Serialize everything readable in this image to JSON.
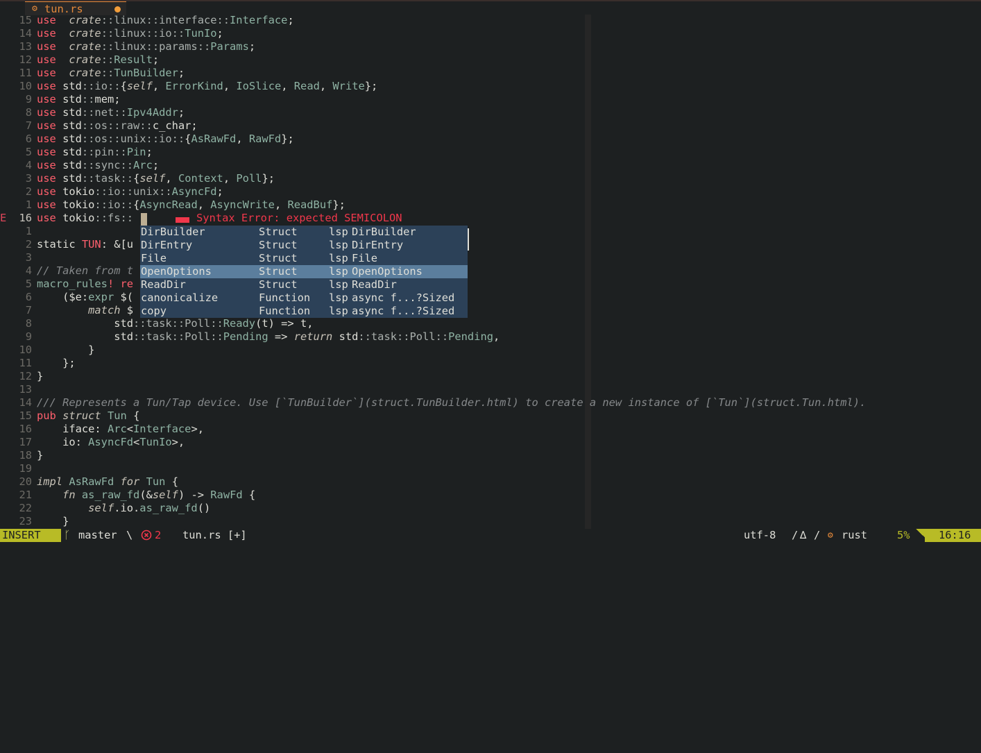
{
  "tab": {
    "icon": "rust-gear-icon",
    "name": "tun.rs",
    "modified": true
  },
  "lines": [
    {
      "num": "15",
      "parts": [
        [
          "kw",
          "use"
        ],
        [
          "",
          "  "
        ],
        [
          "it",
          "crate"
        ],
        [
          "ns",
          "::linux::interface::"
        ],
        [
          "ty",
          "Interface"
        ],
        [
          "",
          ";"
        ]
      ]
    },
    {
      "num": "14",
      "parts": [
        [
          "kw",
          "use"
        ],
        [
          "",
          "  "
        ],
        [
          "it",
          "crate"
        ],
        [
          "ns",
          "::linux::io::"
        ],
        [
          "ty",
          "TunIo"
        ],
        [
          "",
          ";"
        ]
      ]
    },
    {
      "num": "13",
      "parts": [
        [
          "kw",
          "use"
        ],
        [
          "",
          "  "
        ],
        [
          "it",
          "crate"
        ],
        [
          "ns",
          "::linux::params::"
        ],
        [
          "ty",
          "Params"
        ],
        [
          "",
          ";"
        ]
      ]
    },
    {
      "num": "12",
      "parts": [
        [
          "kw",
          "use"
        ],
        [
          "",
          "  "
        ],
        [
          "it",
          "crate"
        ],
        [
          "ns",
          "::"
        ],
        [
          "ty",
          "Result"
        ],
        [
          "",
          ";"
        ]
      ]
    },
    {
      "num": "11",
      "parts": [
        [
          "kw",
          "use"
        ],
        [
          "",
          "  "
        ],
        [
          "it",
          "crate"
        ],
        [
          "ns",
          "::"
        ],
        [
          "ty",
          "TunBuilder"
        ],
        [
          "",
          ";"
        ]
      ]
    },
    {
      "num": "10",
      "parts": [
        [
          "kw",
          "use"
        ],
        [
          "",
          " std"
        ],
        [
          "ns",
          "::io::"
        ],
        [
          "",
          "{"
        ],
        [
          "it",
          "self"
        ],
        [
          "",
          ", "
        ],
        [
          "ty",
          "ErrorKind"
        ],
        [
          "",
          ", "
        ],
        [
          "ty",
          "IoSlice"
        ],
        [
          "",
          ", "
        ],
        [
          "ty",
          "Read"
        ],
        [
          "",
          ", "
        ],
        [
          "ty",
          "Write"
        ],
        [
          "",
          "};"
        ]
      ]
    },
    {
      "num": "9",
      "parts": [
        [
          "kw",
          "use"
        ],
        [
          "",
          " std"
        ],
        [
          "ns",
          "::"
        ],
        [
          "",
          "mem;"
        ]
      ]
    },
    {
      "num": "8",
      "parts": [
        [
          "kw",
          "use"
        ],
        [
          "",
          " std"
        ],
        [
          "ns",
          "::net::"
        ],
        [
          "ty",
          "Ipv4Addr"
        ],
        [
          "",
          ";"
        ]
      ]
    },
    {
      "num": "7",
      "parts": [
        [
          "kw",
          "use"
        ],
        [
          "",
          " std"
        ],
        [
          "ns",
          "::os::raw::"
        ],
        [
          "",
          "c_char;"
        ]
      ]
    },
    {
      "num": "6",
      "parts": [
        [
          "kw",
          "use"
        ],
        [
          "",
          " std"
        ],
        [
          "ns",
          "::os::unix::io::"
        ],
        [
          "",
          "{"
        ],
        [
          "ty",
          "AsRawFd"
        ],
        [
          "",
          ", "
        ],
        [
          "ty",
          "RawFd"
        ],
        [
          "",
          "};"
        ]
      ]
    },
    {
      "num": "5",
      "parts": [
        [
          "kw",
          "use"
        ],
        [
          "",
          " std"
        ],
        [
          "ns",
          "::pin::"
        ],
        [
          "ty",
          "Pin"
        ],
        [
          "",
          ";"
        ]
      ]
    },
    {
      "num": "4",
      "parts": [
        [
          "kw",
          "use"
        ],
        [
          "",
          " std"
        ],
        [
          "ns",
          "::sync::"
        ],
        [
          "ty",
          "Arc"
        ],
        [
          "",
          ";"
        ]
      ]
    },
    {
      "num": "3",
      "parts": [
        [
          "kw",
          "use"
        ],
        [
          "",
          " std"
        ],
        [
          "ns",
          "::task::"
        ],
        [
          "",
          "{"
        ],
        [
          "it",
          "self"
        ],
        [
          "",
          ", "
        ],
        [
          "ty",
          "Context"
        ],
        [
          "",
          ", "
        ],
        [
          "ty",
          "Poll"
        ],
        [
          "",
          "};"
        ]
      ]
    },
    {
      "num": "2",
      "parts": [
        [
          "kw",
          "use"
        ],
        [
          "",
          " tokio"
        ],
        [
          "ns",
          "::io::unix::"
        ],
        [
          "ty",
          "AsyncFd"
        ],
        [
          "",
          ";"
        ]
      ]
    },
    {
      "num": "1",
      "parts": [
        [
          "kw",
          "use"
        ],
        [
          "",
          " tokio"
        ],
        [
          "ns",
          "::io::"
        ],
        [
          "",
          "{"
        ],
        [
          "ty",
          "AsyncRead"
        ],
        [
          "",
          ", "
        ],
        [
          "ty",
          "AsyncWrite"
        ],
        [
          "",
          ", "
        ],
        [
          "ty",
          "ReadBuf"
        ],
        [
          "",
          "};"
        ]
      ]
    },
    {
      "num": "16",
      "current": true,
      "sign": "E",
      "parts": [
        [
          "kw",
          "use"
        ],
        [
          "",
          " tokio"
        ],
        [
          "ns",
          "::fs::"
        ]
      ]
    },
    {
      "num": "1",
      "parts": []
    },
    {
      "num": "2",
      "parts": [
        [
          "",
          "static "
        ],
        [
          "kw",
          "TUN"
        ],
        [
          "",
          ": &[u"
        ]
      ]
    },
    {
      "num": "3",
      "parts": []
    },
    {
      "num": "4",
      "parts": [
        [
          "cm",
          "// Taken from t"
        ]
      ]
    },
    {
      "num": "5",
      "parts": [
        [
          "ty",
          "macro_rules"
        ],
        [
          "kw",
          "! re"
        ]
      ]
    },
    {
      "num": "6",
      "parts": [
        [
          "",
          "    ($e:"
        ],
        [
          "ty",
          "expr"
        ],
        [
          "",
          " $("
        ]
      ]
    },
    {
      "num": "7",
      "parts": [
        [
          "",
          "        "
        ],
        [
          "it",
          "match"
        ],
        [
          "",
          " $"
        ]
      ]
    },
    {
      "num": "8",
      "parts": [
        [
          "",
          "            std"
        ],
        [
          "ns",
          "::task::Poll::"
        ],
        [
          "ty",
          "Ready"
        ],
        [
          "",
          "(t) => t,"
        ]
      ]
    },
    {
      "num": "9",
      "parts": [
        [
          "",
          "            std"
        ],
        [
          "ns",
          "::task::Poll::"
        ],
        [
          "ty",
          "Pending"
        ],
        [
          "",
          " => "
        ],
        [
          "it",
          "return"
        ],
        [
          "",
          " std"
        ],
        [
          "ns",
          "::task::Poll::"
        ],
        [
          "ty",
          "Pending"
        ],
        [
          "",
          ","
        ]
      ]
    },
    {
      "num": "10",
      "parts": [
        [
          "",
          "        }"
        ]
      ]
    },
    {
      "num": "11",
      "parts": [
        [
          "",
          "    };"
        ]
      ]
    },
    {
      "num": "12",
      "parts": [
        [
          "",
          "}"
        ]
      ]
    },
    {
      "num": "13",
      "parts": []
    },
    {
      "num": "14",
      "parts": [
        [
          "cm",
          "/// Represents a Tun/Tap device. Use [`TunBuilder`](struct.TunBuilder.html) to create a new instance of [`Tun`](struct.Tun.html)."
        ]
      ]
    },
    {
      "num": "15",
      "parts": [
        [
          "kw",
          "pub"
        ],
        [
          "",
          " "
        ],
        [
          "it",
          "struct"
        ],
        [
          "",
          " "
        ],
        [
          "ty",
          "Tun"
        ],
        [
          "",
          " {"
        ]
      ]
    },
    {
      "num": "16",
      "parts": [
        [
          "",
          "    iface: "
        ],
        [
          "ty",
          "Arc"
        ],
        [
          "",
          "<"
        ],
        [
          "ty",
          "Interface"
        ],
        [
          "",
          ">,"
        ]
      ]
    },
    {
      "num": "17",
      "parts": [
        [
          "",
          "    io: "
        ],
        [
          "ty",
          "AsyncFd"
        ],
        [
          "",
          "<"
        ],
        [
          "ty",
          "TunIo"
        ],
        [
          "",
          ">,"
        ]
      ]
    },
    {
      "num": "18",
      "parts": [
        [
          "",
          "}"
        ]
      ]
    },
    {
      "num": "19",
      "parts": []
    },
    {
      "num": "20",
      "parts": [
        [
          "it",
          "impl"
        ],
        [
          "",
          " "
        ],
        [
          "ty",
          "AsRawFd"
        ],
        [
          "",
          " "
        ],
        [
          "it",
          "for"
        ],
        [
          "",
          " "
        ],
        [
          "ty",
          "Tun"
        ],
        [
          "",
          " {"
        ]
      ]
    },
    {
      "num": "21",
      "parts": [
        [
          "",
          "    "
        ],
        [
          "it",
          "fn"
        ],
        [
          "",
          " "
        ],
        [
          "ty",
          "as_raw_fd"
        ],
        [
          "",
          "(&"
        ],
        [
          "it",
          "self"
        ],
        [
          "",
          ") -> "
        ],
        [
          "ty",
          "RawFd"
        ],
        [
          "",
          " {"
        ]
      ]
    },
    {
      "num": "22",
      "parts": [
        [
          "",
          "        "
        ],
        [
          "it",
          "self"
        ],
        [
          "",
          ".io."
        ],
        [
          "ty",
          "as_raw_fd"
        ],
        [
          "",
          "()"
        ]
      ]
    },
    {
      "num": "23",
      "parts": [
        [
          "",
          "    }"
        ]
      ]
    }
  ],
  "diagnostic": {
    "message": "Syntax Error: expected SEMICOLON",
    "icon": "error-block-icon"
  },
  "completion": {
    "items": [
      {
        "word": "DirBuilder",
        "kind": "Struct",
        "menu": "lsp",
        "info": "DirBuilder",
        "selected": false
      },
      {
        "word": "DirEntry",
        "kind": "Struct",
        "menu": "lsp",
        "info": "DirEntry",
        "selected": false
      },
      {
        "word": "File",
        "kind": "Struct",
        "menu": "lsp",
        "info": "File",
        "selected": false
      },
      {
        "word": "OpenOptions",
        "kind": "Struct",
        "menu": "lsp",
        "info": "OpenOptions",
        "selected": true
      },
      {
        "word": "ReadDir",
        "kind": "Struct",
        "menu": "lsp",
        "info": "ReadDir",
        "selected": false
      },
      {
        "word": "canonicalize",
        "kind": "Function",
        "menu": "lsp",
        "info": "async f...?Sized",
        "selected": false
      },
      {
        "word": "copy",
        "kind": "Function",
        "menu": "lsp",
        "info": "async f...?Sized",
        "selected": false
      }
    ]
  },
  "status": {
    "mode": "INSERT",
    "branch_icon": "git-branch-icon",
    "branch": "master",
    "separator": "\\",
    "error_icon": "error-circle-icon",
    "errors": "2",
    "file": "tun.rs [+]",
    "encoding": "utf-8",
    "slash": "/",
    "os_icon": "linux-icon",
    "filetype_icon": "rust-gear-icon",
    "filetype": "rust",
    "percent": "5%",
    "position": "16:16"
  }
}
